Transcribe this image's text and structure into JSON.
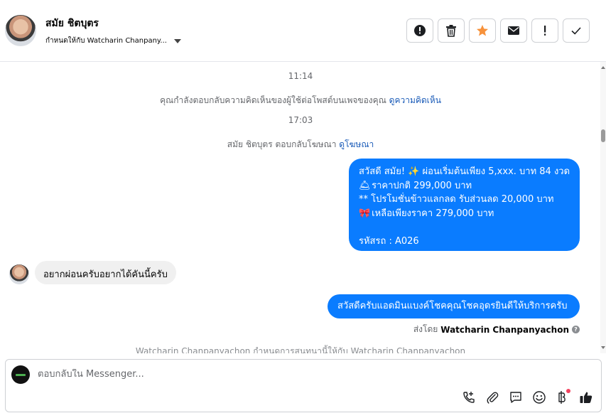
{
  "header": {
    "contact_name": "สมัย ชิตบุตร",
    "assigned_to": "กำหนดให้กับ Watcharin Chanpany...",
    "actions": [
      {
        "name": "spam",
        "icon": "alert-circle-icon"
      },
      {
        "name": "delete",
        "icon": "trash-icon"
      },
      {
        "name": "star",
        "icon": "star-icon"
      },
      {
        "name": "mark-unread",
        "icon": "envelope-icon"
      },
      {
        "name": "follow-up",
        "icon": "exclamation-icon"
      },
      {
        "name": "done",
        "icon": "check-icon"
      }
    ]
  },
  "thread": {
    "time1": "11:14",
    "sys1_text": "คุณกำลังตอบกลับความคิดเห็นของผู้ใช้ต่อโพสต์บนเพจของคุณ",
    "sys1_link": "ดูความคิดเห็น",
    "time2": "17:03",
    "sys2_text": "สมัย ชิตบุตร ตอบกลับโฆษณา",
    "sys2_link": "ดูโฆษณา",
    "ad_message": {
      "line1": "สวัสดี สมัย! ✨  ผ่อนเริ่มต้นเพียง 5,xxx. บาท 84 งวด",
      "line2_icon": "🛎",
      "line2": "ราคาปกติ 299,000 บาท",
      "line3": "** โปรโมชั่นข้าวแลกลด รับส่วนลด 20,000 บาท",
      "line4_icon": "🎀",
      "line4": " เหลือเพียงราคา 279,000 บาท",
      "line5": "รหัสรถ : A026"
    },
    "incoming_message": "อยากผ่อนครับอยากได้คันนี้ครับ",
    "reply_message": "สวัสดีครับแอดมินแบงค์โชคคุณโชคอุดรยินดีให้บริการครับ",
    "sent_by_label": "ส่งโดย",
    "sent_by_name": "Watcharin Chanpanyachon",
    "assignment_note": "Watcharin Chanpanyachon กำหนดการสนทนานี้ให้กับ Watcharin Chanpanyachon"
  },
  "composer": {
    "placeholder": "ตอบกลับใน Messenger...",
    "tools": [
      "call-add-icon",
      "attachment-icon",
      "saved-reply-icon",
      "emoji-icon",
      "baht-payment-icon",
      "like-icon"
    ]
  },
  "colors": {
    "accent": "#0a7cff",
    "star": "#f7923b",
    "link": "#1a5bb8"
  }
}
